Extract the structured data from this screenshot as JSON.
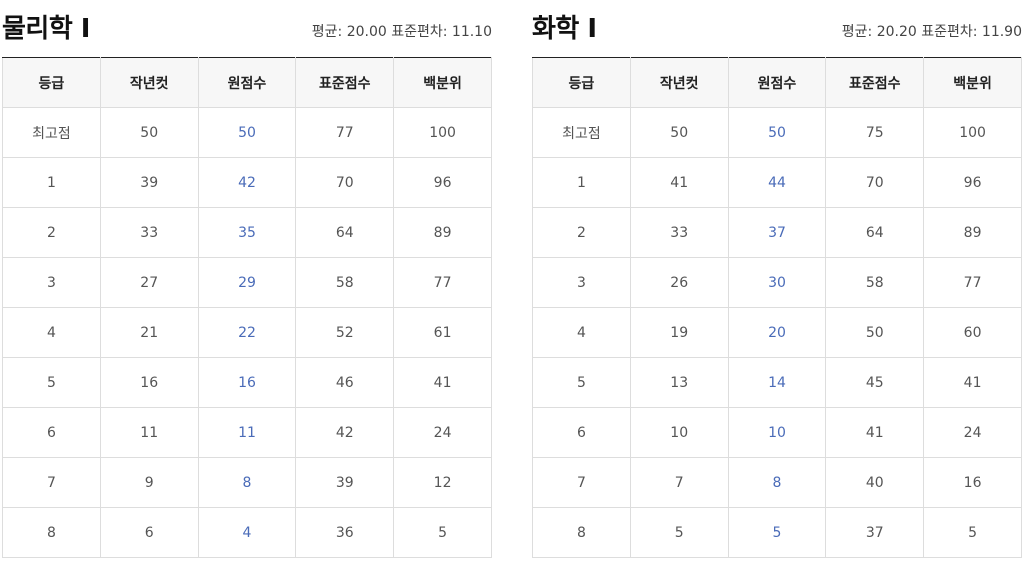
{
  "colors": {
    "raw_score_text": "#4a6bb8",
    "header_background": "#f7f7f7",
    "table_top_border": "#222222"
  },
  "headers": [
    "등급",
    "작년컷",
    "원점수",
    "표준점수",
    "백분위"
  ],
  "panels": [
    {
      "title": "물리학 Ⅰ",
      "stats": "평균: 20.00 표준편차: 11.10",
      "rows": [
        [
          "최고점",
          "50",
          "50",
          "77",
          "100"
        ],
        [
          "1",
          "39",
          "42",
          "70",
          "96"
        ],
        [
          "2",
          "33",
          "35",
          "64",
          "89"
        ],
        [
          "3",
          "27",
          "29",
          "58",
          "77"
        ],
        [
          "4",
          "21",
          "22",
          "52",
          "61"
        ],
        [
          "5",
          "16",
          "16",
          "46",
          "41"
        ],
        [
          "6",
          "11",
          "11",
          "42",
          "24"
        ],
        [
          "7",
          "9",
          "8",
          "39",
          "12"
        ],
        [
          "8",
          "6",
          "4",
          "36",
          "5"
        ]
      ]
    },
    {
      "title": "화학 Ⅰ",
      "stats": "평균: 20.20 표준편차: 11.90",
      "rows": [
        [
          "최고점",
          "50",
          "50",
          "75",
          "100"
        ],
        [
          "1",
          "41",
          "44",
          "70",
          "96"
        ],
        [
          "2",
          "33",
          "37",
          "64",
          "89"
        ],
        [
          "3",
          "26",
          "30",
          "58",
          "77"
        ],
        [
          "4",
          "19",
          "20",
          "50",
          "60"
        ],
        [
          "5",
          "13",
          "14",
          "45",
          "41"
        ],
        [
          "6",
          "10",
          "10",
          "41",
          "24"
        ],
        [
          "7",
          "7",
          "8",
          "40",
          "16"
        ],
        [
          "8",
          "5",
          "5",
          "37",
          "5"
        ]
      ]
    }
  ]
}
